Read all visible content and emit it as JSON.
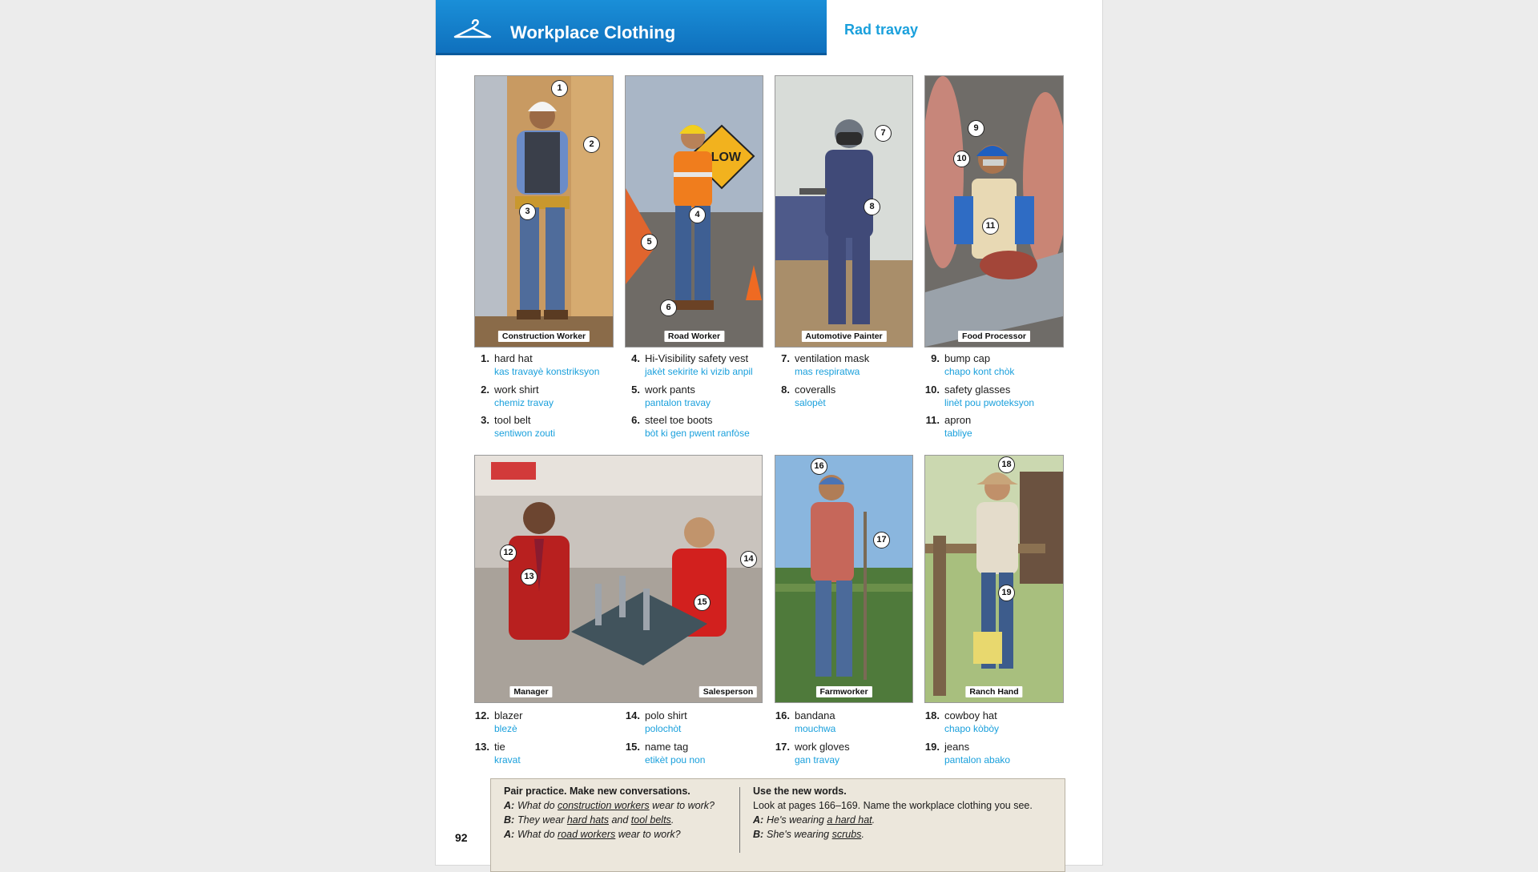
{
  "header": {
    "title": "Workplace Clothing",
    "subtitle": "Rad travay"
  },
  "panels": [
    {
      "caption": "Construction Worker"
    },
    {
      "caption": "Road Worker"
    },
    {
      "caption": "Automotive Painter"
    },
    {
      "caption": "Food Processor"
    },
    {
      "caption": "Manager"
    },
    {
      "caption": "Salesperson"
    },
    {
      "caption": "Farmworker"
    },
    {
      "caption": "Ranch Hand"
    }
  ],
  "markers": [
    "1",
    "2",
    "3",
    "4",
    "5",
    "6",
    "7",
    "8",
    "9",
    "10",
    "11",
    "12",
    "13",
    "14",
    "15",
    "16",
    "17",
    "18",
    "19"
  ],
  "vocab": [
    {
      "num": "1.",
      "en": "hard hat",
      "ht": "kas travayè konstriksyon"
    },
    {
      "num": "2.",
      "en": "work shirt",
      "ht": "chemiz travay"
    },
    {
      "num": "3.",
      "en": "tool belt",
      "ht": "sentiwon zouti"
    },
    {
      "num": "4.",
      "en": "Hi-Visibility safety vest",
      "ht": "jakèt sekirite ki vizib anpil"
    },
    {
      "num": "5.",
      "en": "work pants",
      "ht": "pantalon travay"
    },
    {
      "num": "6.",
      "en": "steel toe boots",
      "ht": "bòt ki gen pwent ranfòse"
    },
    {
      "num": "7.",
      "en": "ventilation mask",
      "ht": "mas respiratwa"
    },
    {
      "num": "8.",
      "en": "coveralls",
      "ht": "salopèt"
    },
    {
      "num": "9.",
      "en": "bump cap",
      "ht": "chapo kont chòk"
    },
    {
      "num": "10.",
      "en": "safety glasses",
      "ht": "linèt pou pwoteksyon"
    },
    {
      "num": "11.",
      "en": "apron",
      "ht": "tabliye"
    },
    {
      "num": "12.",
      "en": "blazer",
      "ht": "blezè"
    },
    {
      "num": "13.",
      "en": "tie",
      "ht": "kravat"
    },
    {
      "num": "14.",
      "en": "polo shirt",
      "ht": "polochòt"
    },
    {
      "num": "15.",
      "en": "name tag",
      "ht": "etikèt pou non"
    },
    {
      "num": "16.",
      "en": "bandana",
      "ht": "mouchwa"
    },
    {
      "num": "17.",
      "en": "work gloves",
      "ht": "gan travay"
    },
    {
      "num": "18.",
      "en": "cowboy hat",
      "ht": "chapo kòbòy"
    },
    {
      "num": "19.",
      "en": "jeans",
      "ht": "pantalon abako"
    }
  ],
  "practice": {
    "left_heading": "Pair practice. Make new conversations.",
    "left_lines": [
      {
        "sp": "A:",
        "pre": "What do ",
        "u": "construction workers",
        "post": " wear to work?"
      },
      {
        "sp": "B:",
        "pre": "They wear ",
        "u": "hard hats",
        "mid": " and ",
        "u2": "tool belts",
        "post": "."
      },
      {
        "sp": "A:",
        "pre": "What do ",
        "u": "road workers",
        "post": " wear to work?"
      }
    ],
    "right_heading": "Use the new words.",
    "right_intro": "Look at pages 166–169. Name the workplace clothing you see.",
    "right_lines": [
      {
        "sp": "A:",
        "pre": "He's wearing ",
        "u": "a hard hat",
        "post": "."
      },
      {
        "sp": "B:",
        "pre": "She's wearing ",
        "u": "scrubs",
        "post": "."
      }
    ]
  },
  "page_number": "92",
  "colors": {
    "header_blue": "#1080c8",
    "haitian_text": "#1aa0dc",
    "practice_bg": "#ece7dc"
  }
}
